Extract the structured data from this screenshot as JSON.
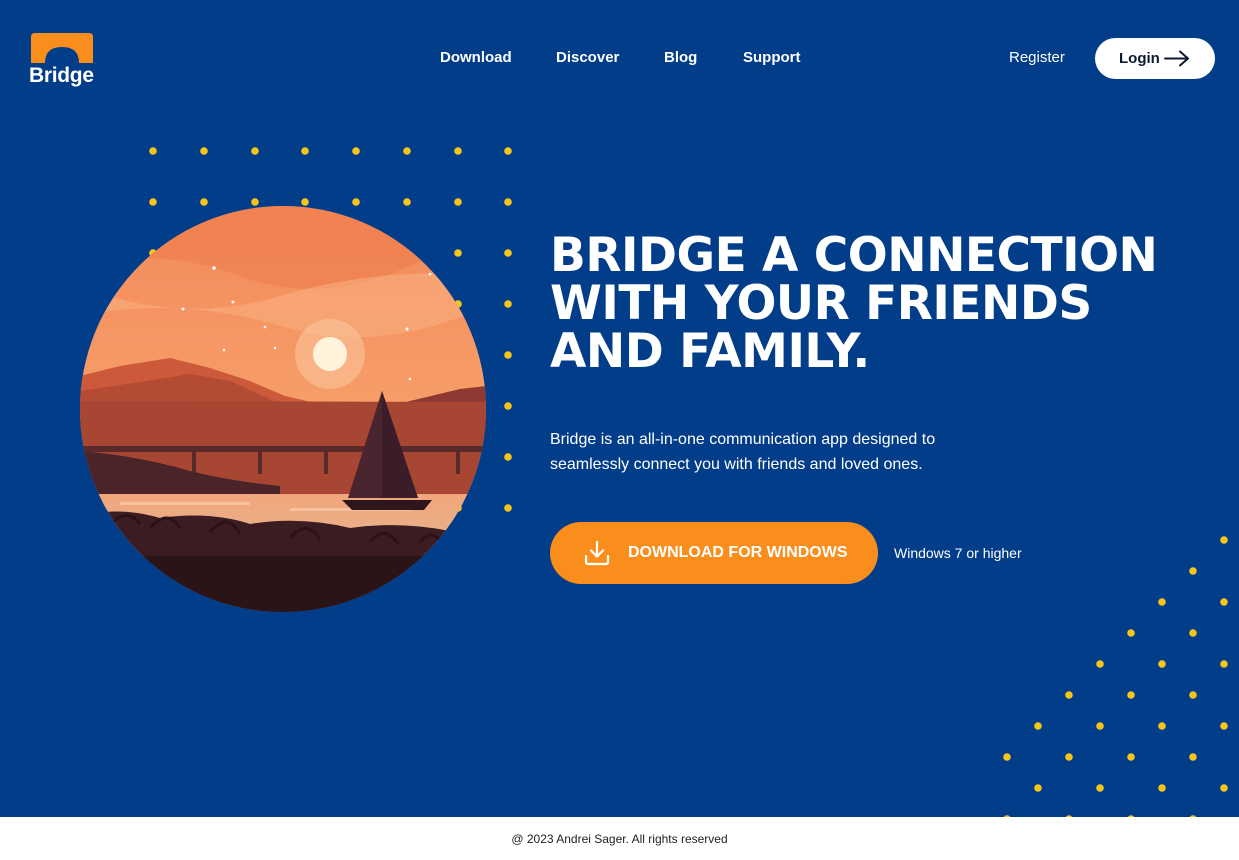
{
  "logo": {
    "text": "Bridge"
  },
  "nav": {
    "items": [
      {
        "label": "Download"
      },
      {
        "label": "Discover"
      },
      {
        "label": "Blog"
      },
      {
        "label": "Support"
      }
    ]
  },
  "auth": {
    "register_label": "Register",
    "login_label": "Login"
  },
  "hero": {
    "headline_lines": [
      "BRIDGE A CONNECTION",
      "WITH YOUR FRIENDS",
      "AND FAMILY."
    ],
    "description": "Bridge is an all-in-one communication app designed to seamlessly connect you with friends and loved ones.",
    "download_label": "DOWNLOAD FOR WINDOWS",
    "requirement": "Windows 7 or higher"
  },
  "footer": {
    "copyright": "@ 2023 Andrei Sager. All rights reserved"
  },
  "colors": {
    "background": "#023d8a",
    "accent": "#fa8e1c",
    "dot": "#f5c518",
    "white": "#ffffff"
  },
  "icons": [
    "bridge-logo-icon",
    "arrow-right-icon",
    "download-icon"
  ]
}
